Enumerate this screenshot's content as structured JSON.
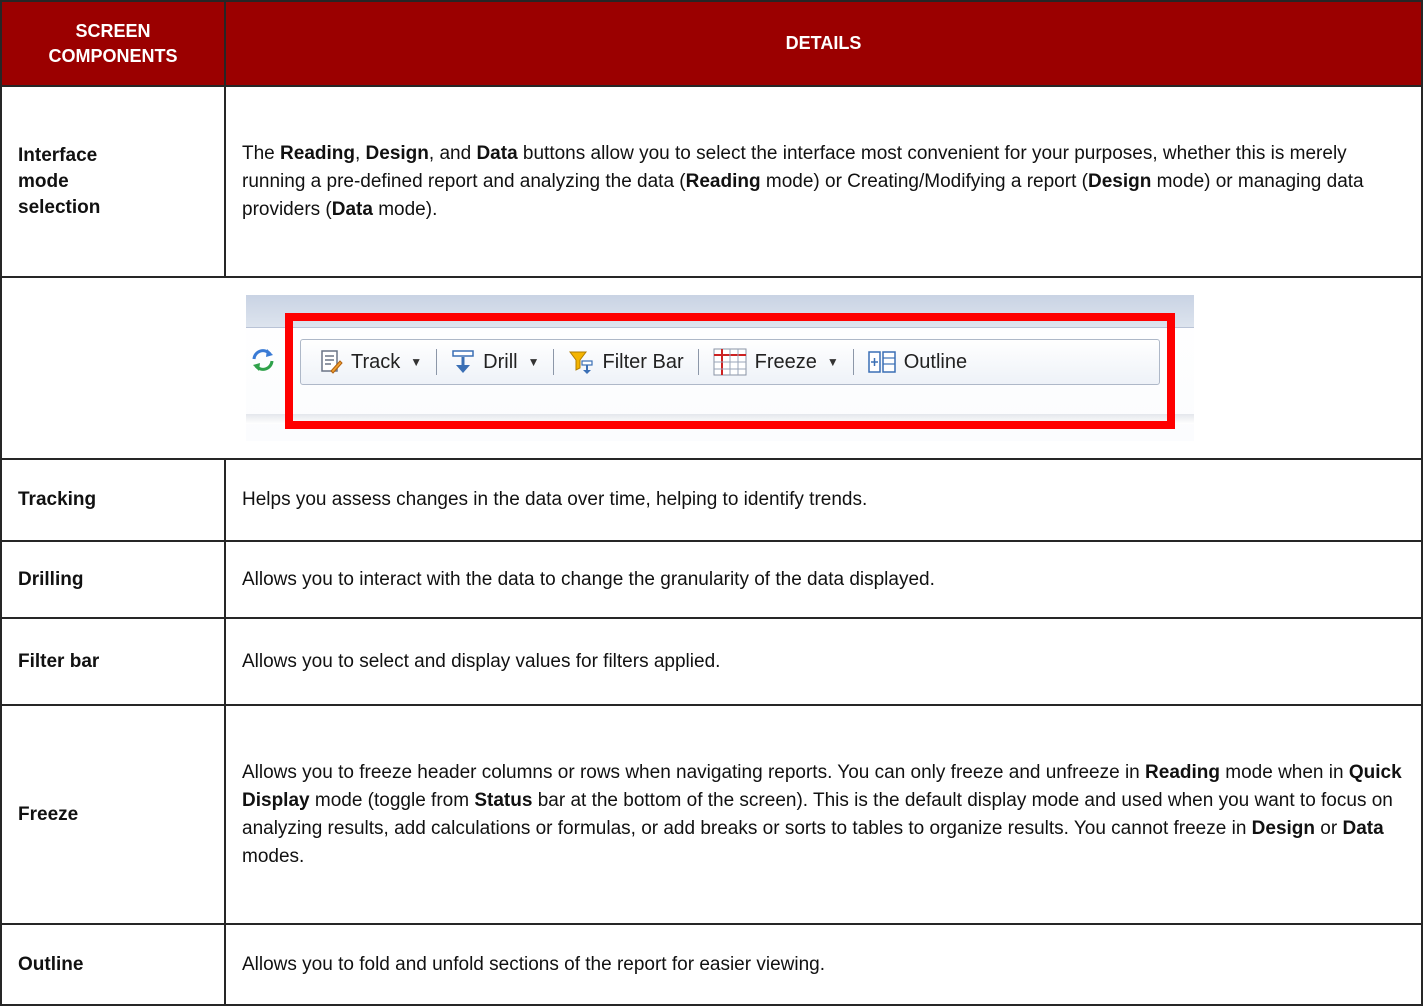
{
  "header": {
    "col1": "SCREEN\nCOMPONENTS",
    "col1_line1": "SCREEN",
    "col1_line2": "COMPONENTS",
    "col2": "DETAILS"
  },
  "rows": {
    "interface": {
      "label_lines": [
        "Interface",
        "mode",
        "selection"
      ],
      "parts": [
        "The ",
        "Reading",
        ", ",
        "Design",
        ", and ",
        "Data",
        " buttons allow you to select the interface most convenient for your purposes, whether this is merely running a pre-defined report and analyzing the data (",
        "Reading",
        " mode) or Creating/Modifying a report (",
        "Design",
        " mode) or managing data providers (",
        "Data",
        " mode)."
      ]
    },
    "tracking": {
      "label": "Tracking",
      "text": "Helps you assess changes in the data over time, helping to identify trends."
    },
    "drilling": {
      "label": "Drilling",
      "text": "Allows you to interact with the data to change the granularity of the data displayed."
    },
    "filterbar": {
      "label": "Filter bar",
      "text": "Allows you to select and display values for filters applied."
    },
    "freeze": {
      "label": "Freeze",
      "parts": [
        "Allows you to freeze header columns or rows when navigating reports. You can only freeze and unfreeze in ",
        "Reading",
        " mode when in ",
        "Quick Display",
        " mode (toggle from ",
        "Status",
        " bar at the bottom of the screen). This is the default display mode and used when you want to focus on analyzing results, add calculations or formulas, or add breaks or sorts to tables to organize results. You cannot freeze in ",
        "Design",
        " or ",
        "Data",
        " modes."
      ]
    },
    "outline": {
      "label": "Outline",
      "text": "Allows you to fold and unfold sections of the report for easier viewing."
    }
  },
  "toolbar": {
    "track": "Track",
    "drill": "Drill",
    "filter_bar": "Filter Bar",
    "freeze": "Freeze",
    "outline": "Outline",
    "caret": "▼",
    "highlight_color": "#ff0000"
  },
  "colors": {
    "header_bg": "#9b0000",
    "header_text": "#ffffff",
    "border": "#262626"
  }
}
